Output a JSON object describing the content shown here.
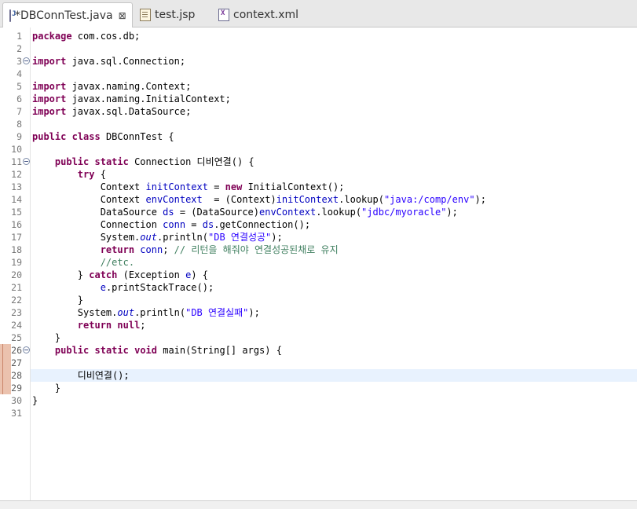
{
  "tabs": [
    {
      "label": "*DBConnTest.java",
      "icon": "java-file-icon",
      "active": true,
      "close": "⊠"
    },
    {
      "label": "test.jsp",
      "icon": "jsp-file-icon",
      "active": false
    },
    {
      "label": "context.xml",
      "icon": "xml-file-icon",
      "active": false
    }
  ],
  "editor": {
    "current_line": 28,
    "modified_lines": [
      26,
      27,
      28,
      29
    ],
    "fold_lines": [
      3,
      11,
      26
    ],
    "lines": [
      "package com.cos.db;",
      "",
      "import java.sql.Connection;",
      "",
      "import javax.naming.Context;",
      "import javax.naming.InitialContext;",
      "import javax.sql.DataSource;",
      "",
      "public class DBConnTest {",
      "",
      "    public static Connection 디비연결() {",
      "        try {",
      "            Context initContext = new InitialContext();",
      "            Context envContext  = (Context)initContext.lookup(\"java:/comp/env\");",
      "            DataSource ds = (DataSource)envContext.lookup(\"jdbc/myoracle\");",
      "            Connection conn = ds.getConnection();",
      "            System.out.println(\"DB 연결성공\");",
      "            return conn; // 리턴을 해줘야 연결성공된채로 유지",
      "            //etc.",
      "        } catch (Exception e) {",
      "            e.printStackTrace();",
      "        }",
      "        System.out.println(\"DB 연결실패\");",
      "        return null;",
      "    }",
      "    public static void main(String[] args) {",
      "",
      "        디비연결();",
      "    }",
      "}",
      ""
    ]
  }
}
